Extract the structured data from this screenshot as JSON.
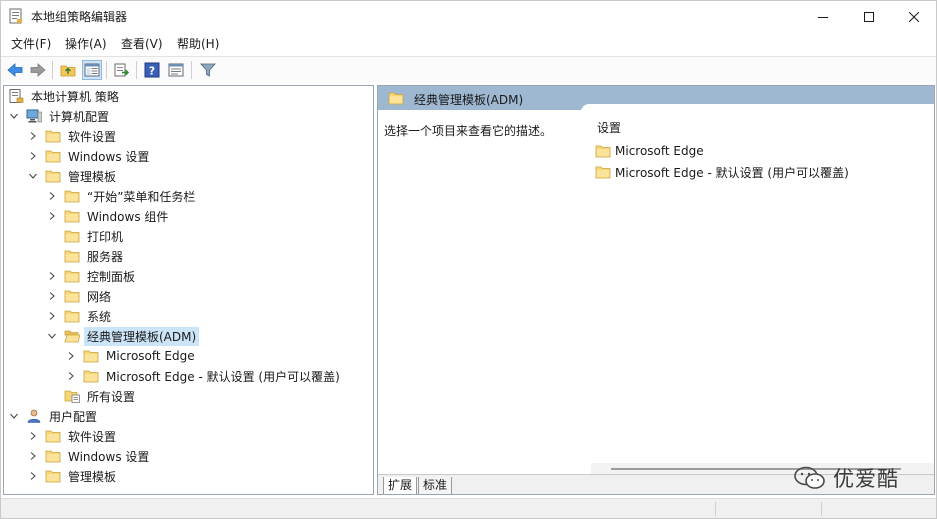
{
  "window": {
    "title": "本地组策略编辑器"
  },
  "menu": [
    {
      "label": "文件(F)"
    },
    {
      "label": "操作(A)"
    },
    {
      "label": "查看(V)"
    },
    {
      "label": "帮助(H)"
    }
  ],
  "toolbar": {
    "buttons": [
      "back-icon",
      "forward-icon",
      "up-folder-icon",
      "show-hide-tree-icon",
      "export-list-icon",
      "help-icon",
      "properties-icon",
      "filter-icon"
    ]
  },
  "tree": {
    "items": [
      {
        "label": "本地计算机 策略",
        "icon": "policy-doc-icon",
        "expander": "none"
      },
      {
        "label": "计算机配置",
        "icon": "computer-icon",
        "expander": "expanded"
      },
      {
        "label": "软件设置",
        "icon": "folder-icon",
        "expander": "collapsed"
      },
      {
        "label": "Windows 设置",
        "icon": "folder-icon",
        "expander": "collapsed"
      },
      {
        "label": "管理模板",
        "icon": "folder-icon",
        "expander": "expanded"
      },
      {
        "label": "“开始”菜单和任务栏",
        "icon": "folder-icon",
        "expander": "collapsed"
      },
      {
        "label": "Windows 组件",
        "icon": "folder-icon",
        "expander": "collapsed"
      },
      {
        "label": "打印机",
        "icon": "folder-icon",
        "expander": "none"
      },
      {
        "label": "服务器",
        "icon": "folder-icon",
        "expander": "none"
      },
      {
        "label": "控制面板",
        "icon": "folder-icon",
        "expander": "collapsed"
      },
      {
        "label": "网络",
        "icon": "folder-icon",
        "expander": "collapsed"
      },
      {
        "label": "系统",
        "icon": "folder-icon",
        "expander": "collapsed"
      },
      {
        "label": "经典管理模板(ADM)",
        "icon": "folder-open-icon",
        "expander": "expanded",
        "selected": true
      },
      {
        "label": "Microsoft Edge",
        "icon": "folder-icon",
        "expander": "collapsed"
      },
      {
        "label": "Microsoft Edge - 默认设置 (用户可以覆盖)",
        "icon": "folder-icon",
        "expander": "collapsed"
      },
      {
        "label": "所有设置",
        "icon": "all-settings-icon",
        "expander": "none"
      },
      {
        "label": "用户配置",
        "icon": "user-icon",
        "expander": "expanded"
      },
      {
        "label": "软件设置",
        "icon": "folder-icon",
        "expander": "collapsed"
      },
      {
        "label": "Windows 设置",
        "icon": "folder-icon",
        "expander": "collapsed"
      },
      {
        "label": "管理模板",
        "icon": "folder-icon",
        "expander": "collapsed"
      }
    ]
  },
  "details": {
    "header": "经典管理模板(ADM)",
    "description": "选择一个项目来查看它的描述。",
    "column_header": "设置",
    "items": [
      {
        "label": "Microsoft Edge"
      },
      {
        "label": "Microsoft Edge - 默认设置 (用户可以覆盖)"
      }
    ]
  },
  "tabs": [
    {
      "label": "扩展",
      "active": true
    },
    {
      "label": "标准",
      "active": false
    }
  ],
  "watermark": {
    "text": "优爱酷"
  }
}
